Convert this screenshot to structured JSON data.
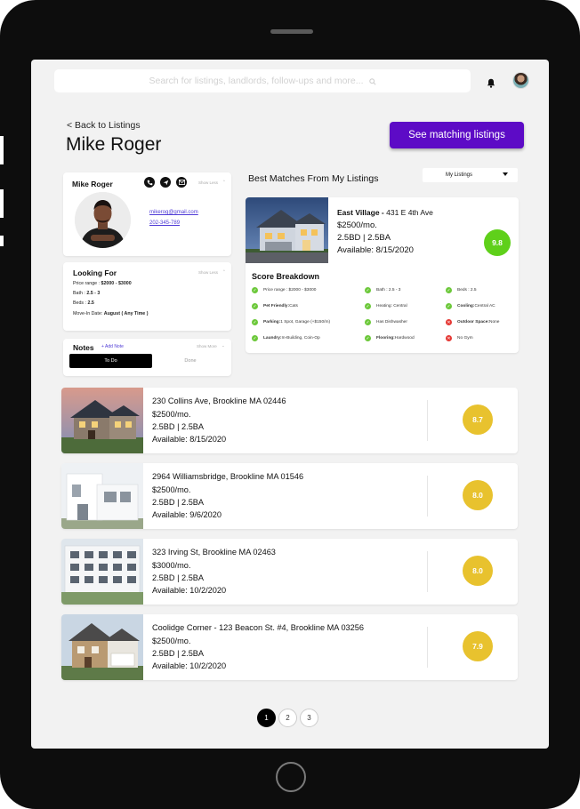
{
  "search": {
    "placeholder": "Search for listings, landlords, follow-ups and more..."
  },
  "header": {
    "back_link": "< Back to Listings",
    "title": "Mike Roger",
    "cta_label": "See matching listings"
  },
  "profile": {
    "name": "Mike Roger",
    "show_less": "Show Less",
    "email": "mikerog@gmail.com",
    "phone": "202-345-789"
  },
  "looking_for": {
    "title": "Looking For",
    "show_less": "Show Less",
    "price": {
      "label": "Price range : ",
      "value": "$2000 - $3000"
    },
    "bath": {
      "label": "Bath : ",
      "value": "2.5 - 3"
    },
    "beds": {
      "label": "Beds : ",
      "value": "2.5"
    },
    "move_in": {
      "label": "Move-In Date: ",
      "value": "August ( Any Time )"
    }
  },
  "notes": {
    "title": "Notes",
    "add_label": "+ Add Note",
    "show_more": "Show More",
    "tab_todo": "To Do",
    "tab_done": "Done"
  },
  "best_matches": {
    "title": "Best Matches From My Listings",
    "filter_value": "My Listings",
    "featured": {
      "name": "East Village - ",
      "address": "431 E 4th Ave",
      "price": "$2500/mo.",
      "beds_baths": "2.5BD | 2.5BA",
      "available": "Available: 8/15/2020",
      "score": "9.8",
      "breakdown_title": "Score Breakdown",
      "criteria": [
        {
          "label": "",
          "text": "Price range : $2000 - $3000",
          "ok": true
        },
        {
          "label": "",
          "text": "Bath : 2.5 - 3",
          "ok": true
        },
        {
          "label": "",
          "text": "Beds : 2.5",
          "ok": true
        },
        {
          "label": "Pet Friendly: ",
          "text": "Cats",
          "ok": true
        },
        {
          "label": "",
          "text": "Heating: Central",
          "ok": true
        },
        {
          "label": "Cooling: ",
          "text": "Central AC",
          "ok": true
        },
        {
          "label": "Parking: ",
          "text": "1 Spot, Garage (+$150/m)",
          "ok": true
        },
        {
          "label": "",
          "text": "Has Dishwasher",
          "ok": true
        },
        {
          "label": "Outdoor Space: ",
          "text": "None",
          "ok": false
        },
        {
          "label": "Laundry: ",
          "text": "In-Building, Coin-Op",
          "ok": true
        },
        {
          "label": "Flooring: ",
          "text": "Hardwood",
          "ok": true
        },
        {
          "label": "",
          "text": "No Gym",
          "ok": false
        }
      ]
    }
  },
  "listings": [
    {
      "address": "230 Collins Ave, Brookline MA 02446",
      "price": "$2500/mo.",
      "beds_baths": "2.5BD | 2.5BA",
      "available": "Available: 8/15/2020",
      "score": "8.7"
    },
    {
      "address": "2964 Williamsbridge, Brookline MA 01546",
      "price": "$2500/mo.",
      "beds_baths": "2.5BD | 2.5BA",
      "available": "Available: 9/6/2020",
      "score": "8.0"
    },
    {
      "address": "323 Irving St, Brookline MA 02463",
      "price": "$3000/mo.",
      "beds_baths": "2.5BD | 2.5BA",
      "available": "Available: 10/2/2020",
      "score": "8.0"
    },
    {
      "address": "Coolidge Corner - 123 Beacon St. #4, Brookline MA 03256",
      "price": "$2500/mo.",
      "beds_baths": "2.5BD | 2.5BA",
      "available": "Available: 10/2/2020",
      "score": "7.9"
    }
  ],
  "pagination": {
    "pages": [
      "1",
      "2",
      "3"
    ],
    "current": "1"
  },
  "colors": {
    "accent": "#5d0bc6",
    "score_high": "#5fd01a",
    "score_mid": "#e8c22e",
    "check": "#6cc83a",
    "cross": "#e53935",
    "link": "#4f3bd6"
  },
  "icons": {
    "search": "search-icon",
    "bell": "bell-icon",
    "phone": "phone-icon",
    "send": "send-icon",
    "mail": "mail-icon"
  }
}
